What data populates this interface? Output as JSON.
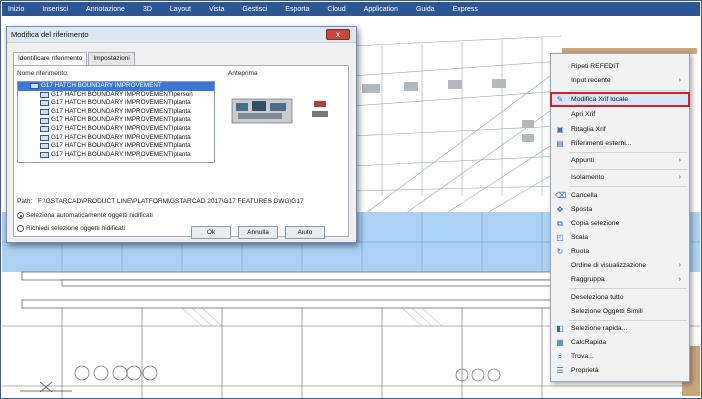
{
  "menubar": {
    "items": [
      "Inizio",
      "Inserisci",
      "Annotazione",
      "3D",
      "Layout",
      "Vista",
      "Gestisci",
      "Esporta",
      "Cloud",
      "Application",
      "Guida",
      "Express"
    ]
  },
  "dialog": {
    "title": "Modifica del riferimento",
    "close_label": "x",
    "tabs": [
      "Identificare riferimento",
      "Impostazioni"
    ],
    "ref_name_label": "Nome riferimento:",
    "preview_label": "Anteprima",
    "tree": [
      "G17 HATCH BOUNDARY IMPROVEMENT",
      "G17 HATCH BOUNDARY IMPROVEMENTIperson",
      "G17 HATCH BOUNDARY IMPROVEMENTIplanta",
      "G17 HATCH BOUNDARY IMPROVEMENTIplanta",
      "G17 HATCH BOUNDARY IMPROVEMENTIplanta",
      "G17 HATCH BOUNDARY IMPROVEMENTIplanta",
      "G17 HATCH BOUNDARY IMPROVEMENTIplanta",
      "G17 HATCH BOUNDARY IMPROVEMENTIplanta",
      "G17 HATCH BOUNDARY IMPROVEMENTIplanta"
    ],
    "path_label": "Path:",
    "path_value": "F:\\GSTARCAD\\PRODUCT LINE\\PLATFORM\\GSTARCAD 2017\\G17 FEATURES DWG\\G17",
    "radio_auto": "Seleziona automaticamente oggetti nidificati",
    "radio_prompt": "Richiedi selezione oggetti nidificati",
    "ok": "Ok",
    "cancel": "Annulla",
    "help": "Aiuto"
  },
  "context_menu": {
    "items": [
      {
        "label": "Ripeti REFEDIT",
        "icon": "",
        "submenu": false
      },
      {
        "label": "Input recente",
        "icon": "",
        "submenu": true
      },
      {
        "label": "Modifica Xrif locale",
        "icon": "edit-xref-icon",
        "submenu": false,
        "highlighted": true
      },
      {
        "label": "Apri Xrif",
        "icon": "",
        "submenu": false
      },
      {
        "label": "Ritaglia Xrif",
        "icon": "clip-icon",
        "submenu": false
      },
      {
        "label": "Riferimenti esterni...",
        "icon": "external-refs-icon",
        "submenu": false
      },
      {
        "label": "Appunti",
        "icon": "",
        "submenu": true
      },
      {
        "label": "Isolamento",
        "icon": "",
        "submenu": true
      },
      {
        "label": "Cancella",
        "icon": "erase-icon",
        "submenu": false
      },
      {
        "label": "Sposta",
        "icon": "move-icon",
        "submenu": false
      },
      {
        "label": "Copia selezione",
        "icon": "copy-icon",
        "submenu": false
      },
      {
        "label": "Scala",
        "icon": "scale-icon",
        "submenu": false
      },
      {
        "label": "Ruota",
        "icon": "rotate-icon",
        "submenu": false
      },
      {
        "label": "Ordine di visualizzazione",
        "icon": "",
        "submenu": true
      },
      {
        "label": "Raggruppa",
        "icon": "",
        "submenu": true
      },
      {
        "label": "Deseleziona tutto",
        "icon": "",
        "submenu": false
      },
      {
        "label": "Selezione Oggetti Simili",
        "icon": "",
        "submenu": false
      },
      {
        "label": "Selezione rapida...",
        "icon": "quick-select-icon",
        "submenu": false
      },
      {
        "label": "CalcRapida",
        "icon": "calculator-icon",
        "submenu": false
      },
      {
        "label": "Trova...",
        "icon": "find-icon",
        "submenu": false
      },
      {
        "label": "Proprietà",
        "icon": "properties-icon",
        "submenu": false
      }
    ]
  },
  "colors": {
    "menubar": "#2b5797",
    "highlight_outline": "#d0202a",
    "glass": "#a9d2f5",
    "wall": "#c9a57a"
  }
}
